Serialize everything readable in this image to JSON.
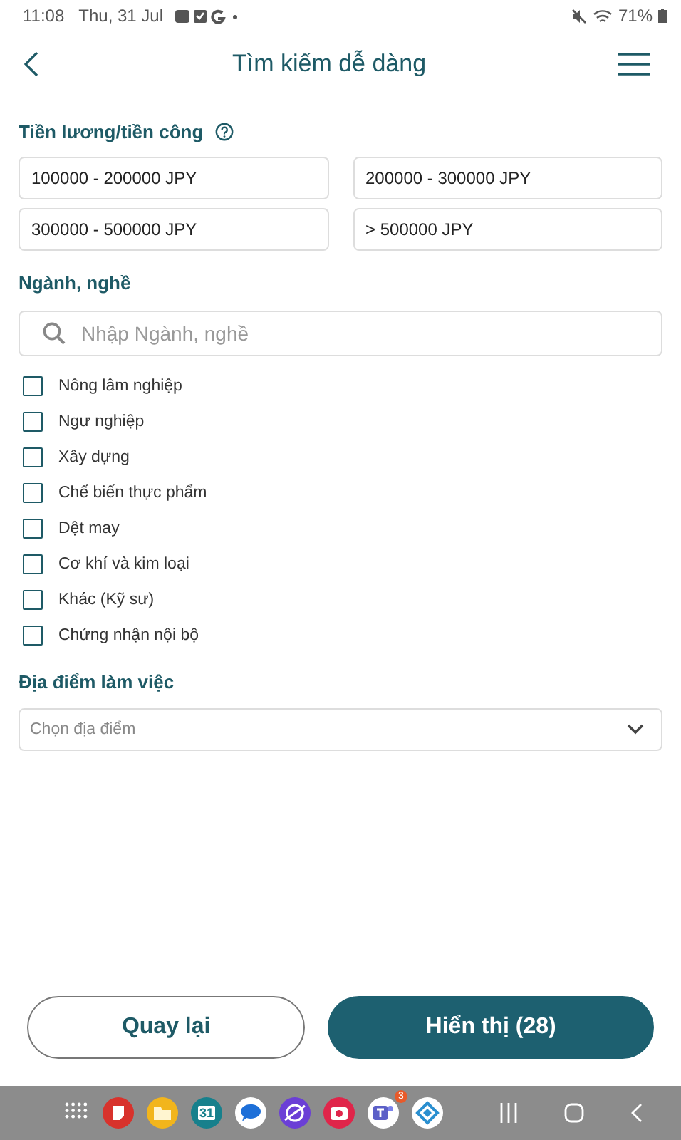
{
  "status_bar": {
    "time": "11:08",
    "date": "Thu, 31 Jul",
    "battery": "71%"
  },
  "header": {
    "title": "Tìm kiếm dễ dàng"
  },
  "salary": {
    "label": "Tiền lương/tiền công",
    "options": [
      {
        "label": "100000 - 200000 JPY",
        "selected": false
      },
      {
        "label": "200000 - 300000 JPY",
        "selected": false
      },
      {
        "label": "300000 - 500000 JPY",
        "selected": false
      },
      {
        "label": "> 500000 JPY",
        "selected": false
      }
    ]
  },
  "industry": {
    "label": "Ngành, nghề",
    "search": {
      "placeholder": "Nhập Ngành, nghề"
    },
    "items": [
      {
        "label": "Nông lâm nghiệp",
        "checked": false
      },
      {
        "label": "Ngư nghiệp",
        "checked": false
      },
      {
        "label": "Xây dựng",
        "checked": false
      },
      {
        "label": "Chế biến thực phẩm",
        "checked": false
      },
      {
        "label": "Dệt may",
        "checked": false
      },
      {
        "label": "Cơ khí và kim loại",
        "checked": false
      },
      {
        "label": "Khác (Kỹ sư)",
        "checked": false
      },
      {
        "label": "Chứng nhận nội bộ",
        "checked": false
      }
    ]
  },
  "location": {
    "label": "Địa điểm làm việc",
    "select": {
      "placeholder": "Chọn địa điểm"
    }
  },
  "buttons": [
    {
      "label": "Quay lại",
      "kind": "outline"
    },
    {
      "label": "Hiển thị (28)",
      "kind": "primary"
    }
  ],
  "taskbar": {
    "apps": [
      {
        "kind": "grid"
      },
      {
        "kind": "notes"
      },
      {
        "kind": "folder"
      },
      {
        "kind": "calendar",
        "text": "31"
      },
      {
        "kind": "chat"
      },
      {
        "kind": "browser"
      },
      {
        "kind": "camera"
      },
      {
        "kind": "teams",
        "badge": "3"
      },
      {
        "kind": "diamond"
      }
    ]
  }
}
